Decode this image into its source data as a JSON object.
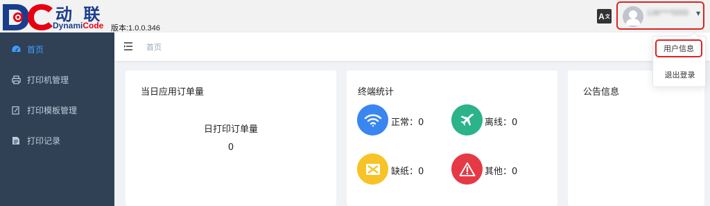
{
  "header": {
    "brand_cn": "动 联",
    "brand_en_prefix": "Dynami",
    "brand_en_suffix": "Code",
    "version": "版本:1.0.0.346",
    "translate_icon": "translate-icon",
    "username": "138****5555"
  },
  "user_menu": {
    "items": [
      "用户信息",
      "退出登录"
    ]
  },
  "sidebar": {
    "items": [
      {
        "label": "首页",
        "icon": "dashboard-icon",
        "active": true
      },
      {
        "label": "打印机管理",
        "icon": "printer-icon",
        "active": false
      },
      {
        "label": "打印模板管理",
        "icon": "edit-icon",
        "active": false
      },
      {
        "label": "打印记录",
        "icon": "document-icon",
        "active": false
      }
    ]
  },
  "navbar": {
    "breadcrumb": "首页"
  },
  "cards": {
    "orders": {
      "title": "当日应用订单量",
      "stat_label": "日打印订单量",
      "stat_value": "0"
    },
    "terminals": {
      "title": "终端统计",
      "items": [
        {
          "label": "正常：0",
          "icon": "wifi-icon",
          "color": "#3a86f0"
        },
        {
          "label": "离线：0",
          "icon": "airplane-icon",
          "color": "#2bb38a"
        },
        {
          "label": "缺纸：0",
          "icon": "paper-out-icon",
          "color": "#f7c326"
        },
        {
          "label": "其他：0",
          "icon": "warning-icon",
          "color": "#e63946"
        }
      ]
    },
    "notice": {
      "title": "公告信息"
    }
  }
}
